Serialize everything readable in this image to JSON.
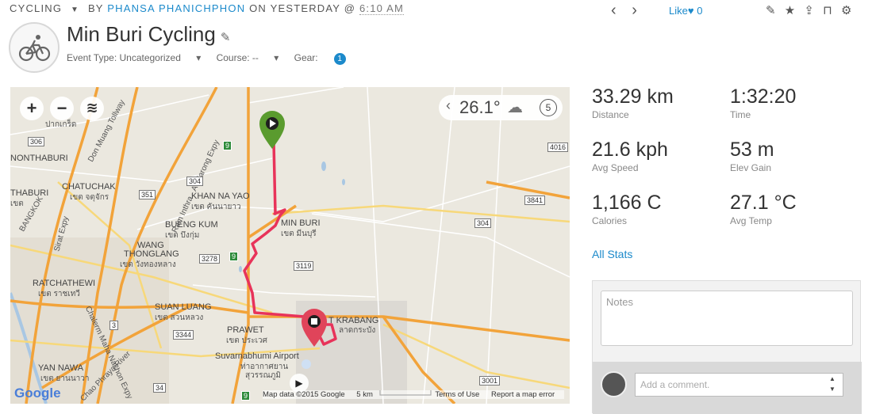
{
  "header": {
    "activity_type": "CYCLING",
    "by_label": "BY",
    "author": "PHANSA PHANICHPHON",
    "on_label": "ON YESTERDAY @",
    "time": "6:10 AM",
    "like_label": "Like",
    "like_count": "0"
  },
  "activity": {
    "title": "Min Buri Cycling",
    "event_type_label": "Event Type: Uncategorized",
    "course_label": "Course: --",
    "gear_label": "Gear:",
    "gear_count": "1"
  },
  "map": {
    "zoom_in": "+",
    "zoom_out": "−",
    "temperature": "26.1°",
    "wind_speed": "5",
    "labels": {
      "min_buri": "MIN BURI",
      "min_buri_th": "เขต มีนบุรี",
      "khan_na_yao": "KHAN NA YAO",
      "khan_na_yao_th": "เขต คันนายาว",
      "bueng_kum": "BUENG KUM",
      "bueng_kum_th": "เขต บึงกุ่ม",
      "wang_thonglang": "WANG",
      "wang_thonglang2": "THONGLANG",
      "wang_thonglang_th": "เขต วังทองหลาง",
      "chatuchak": "CHATUCHAK",
      "chatuchak_th": "เขต จตุจักร",
      "ratchathewi": "RATCHATHEWI",
      "ratchathewi_th": "เขต ราชเทวี",
      "suan_luang": "SUAN LUANG",
      "suan_luang_th": "เขต สวนหลวง",
      "prawet": "PRAWET",
      "prawet_th": "เขต ประเวศ",
      "lat_krabang": "T KRABANG",
      "lat_krabang_th": "ลาดกระบัง",
      "airport": "Suvarnabhumi Airport",
      "airport_th": "ท่าอากาศยาน",
      "airport_th2": "สุวรรณภูมิ",
      "yan_nawa": "YAN NAWA",
      "yan_nawa_th": "เขต ยานนาวา",
      "nonthaburi": "NONTHABURI",
      "pak_kret": "ปากเกร็ด",
      "bangkok": "BANGKOK",
      "thaburi": "THABURI",
      "thaburi_th": "เขต",
      "don_muang": "Don Muang Tollway",
      "ram_inthra": "Ram Inthra - At Narong Expy",
      "sirat": "Sirat Expy",
      "chalerm": "Chalerm Maha Nakhon Expy",
      "chao_phraya": "Chao Phraya River"
    },
    "shields": {
      "r306": "306",
      "r351": "351",
      "r304a": "304",
      "r304b": "304",
      "r3278": "3278",
      "r3119": "3119",
      "r3841": "3841",
      "r4016": "4016",
      "r3344": "3344",
      "r3": "3",
      "r34": "34",
      "r3001": "3001",
      "g9a": "9",
      "g9b": "9",
      "g9c": "9"
    },
    "google": "Google",
    "attribution": "Map data ©2015 Google",
    "scale": "5 km",
    "terms": "Terms of Use",
    "report": "Report a map error"
  },
  "stats": {
    "distance_value": "33.29 km",
    "distance_label": "Distance",
    "time_value": "1:32:20",
    "time_label": "Time",
    "speed_value": "21.6 kph",
    "speed_label": "Avg Speed",
    "elev_value": "53 m",
    "elev_label": "Elev Gain",
    "calories_value": "1,166 C",
    "calories_label": "Calories",
    "temp_value": "27.1 °C",
    "temp_label": "Avg Temp",
    "all_stats_label": "All Stats"
  },
  "notes": {
    "placeholder": "Notes",
    "comment_placeholder": "Add a comment."
  },
  "colors": {
    "accent": "#1c8acb",
    "route": "#e8335a",
    "start_pin": "#5a9b2e",
    "end_pin": "#e0445a"
  }
}
